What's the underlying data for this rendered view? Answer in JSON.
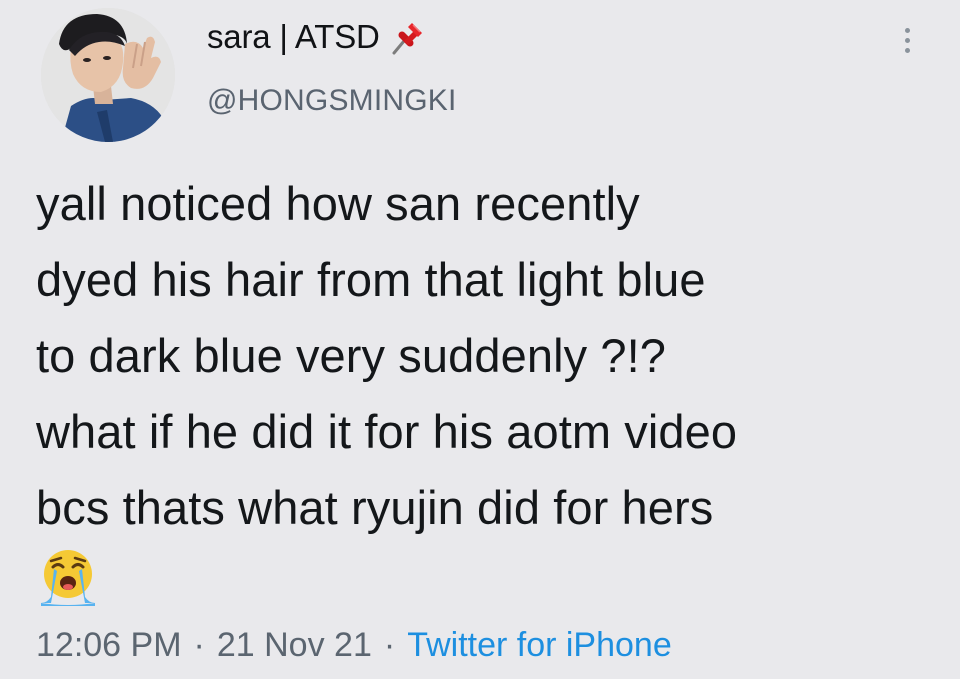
{
  "tweet": {
    "author": {
      "display_name": "sara | ATSD",
      "name_emoji": "pushpin-emoji",
      "handle": "@HONGSMINGKI"
    },
    "text_lines": [
      "yall noticed how san recently",
      "dyed his hair from that light blue",
      "to dark blue very suddenly ?!?",
      "what if he did it for his aotm video",
      "bcs thats what ryujin did for hers"
    ],
    "trailing_emoji": "loudly-crying-face-emoji",
    "meta": {
      "time": "12:06 PM",
      "separator": "·",
      "date": "21 Nov 21",
      "source": "Twitter for iPhone"
    },
    "colors": {
      "background": "#e9e9ec",
      "text": "#14171a",
      "secondary_text": "#5b6570",
      "link": "#1d8fe0"
    }
  }
}
